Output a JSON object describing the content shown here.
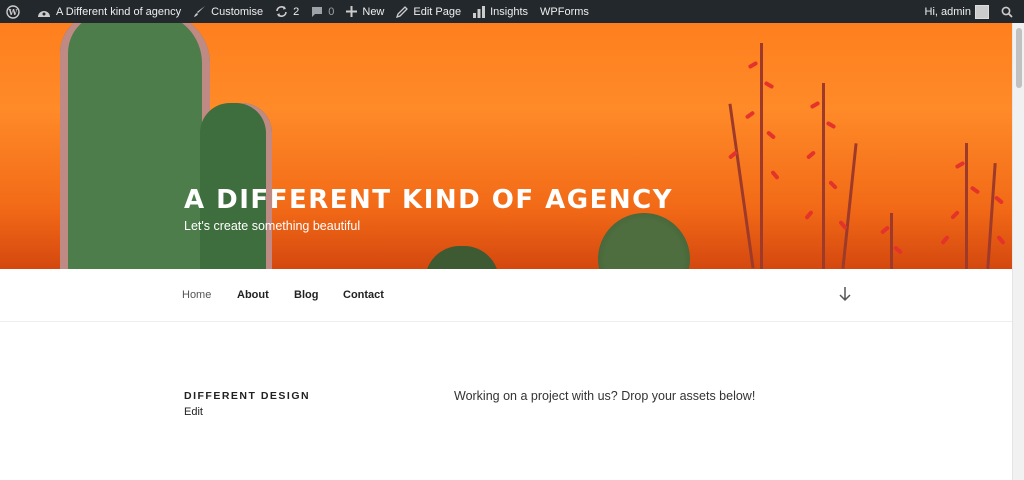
{
  "adminbar": {
    "site_name": "A Different kind of agency",
    "customise": "Customise",
    "updates_count": "2",
    "comments_count": "0",
    "new_label": "New",
    "edit_page": "Edit Page",
    "insights": "Insights",
    "wpforms": "WPForms",
    "greeting": "Hi, admin"
  },
  "header": {
    "title": "A DIFFERENT KIND OF AGENCY",
    "tagline": "Let's create something beautiful",
    "accent": "#ff7f1e"
  },
  "nav": {
    "items": [
      "Home",
      "About",
      "Blog",
      "Contact"
    ]
  },
  "content": {
    "title": "DIFFERENT DESIGN",
    "edit": "Edit",
    "text": "Working on a project with us? Drop your assets below!"
  },
  "colors": {
    "adminbar_bg": "#23282d",
    "text_dark": "#222222"
  }
}
